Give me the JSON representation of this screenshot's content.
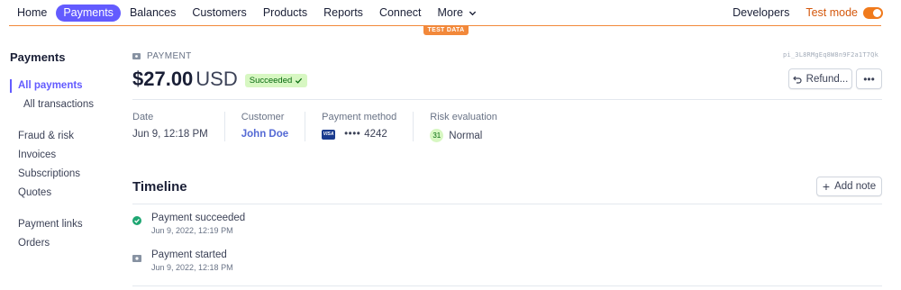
{
  "nav": {
    "items": [
      {
        "label": "Home",
        "active": false
      },
      {
        "label": "Payments",
        "active": true
      },
      {
        "label": "Balances",
        "active": false
      },
      {
        "label": "Customers",
        "active": false
      },
      {
        "label": "Products",
        "active": false
      },
      {
        "label": "Reports",
        "active": false
      },
      {
        "label": "Connect",
        "active": false
      },
      {
        "label": "More",
        "active": false
      }
    ],
    "developers_label": "Developers",
    "test_mode_label": "Test mode",
    "test_mode_on": true,
    "test_data_badge": "TEST DATA"
  },
  "sidebar": {
    "title": "Payments",
    "items": [
      {
        "label": "All payments"
      },
      {
        "label": "All transactions"
      },
      {
        "label": "Fraud & risk"
      },
      {
        "label": "Invoices"
      },
      {
        "label": "Subscriptions"
      },
      {
        "label": "Quotes"
      },
      {
        "label": "Payment links"
      },
      {
        "label": "Orders"
      }
    ]
  },
  "payment": {
    "kind_label": "PAYMENT",
    "id_text": "pi_3L8RMgEq8W8n9F2a1T7Qk",
    "amount": "$27.00",
    "currency": "USD",
    "status": "Succeeded",
    "refund_label": "Refund...",
    "more_label": "•••"
  },
  "meta": {
    "date_label": "Date",
    "date_value": "Jun 9, 12:18 PM",
    "customer_label": "Customer",
    "customer_value": "John Doe",
    "method_label": "Payment method",
    "card_brand": "VISA",
    "card_dots": "••••",
    "card_last4": "4242",
    "risk_label": "Risk evaluation",
    "risk_score": "31",
    "risk_level": "Normal"
  },
  "timeline": {
    "title": "Timeline",
    "add_note_label": "Add note",
    "events": [
      {
        "title": "Payment succeeded",
        "time": "Jun 9, 2022, 12:19 PM",
        "icon": "check-circle-icon"
      },
      {
        "title": "Payment started",
        "time": "Jun 9, 2022, 12:18 PM",
        "icon": "bill-icon"
      }
    ]
  },
  "colors": {
    "accent": "#635bff",
    "test_mode": "#f2883a",
    "success_bg": "#d7f7c2",
    "success_text": "#05690d",
    "link": "#5469d4"
  }
}
